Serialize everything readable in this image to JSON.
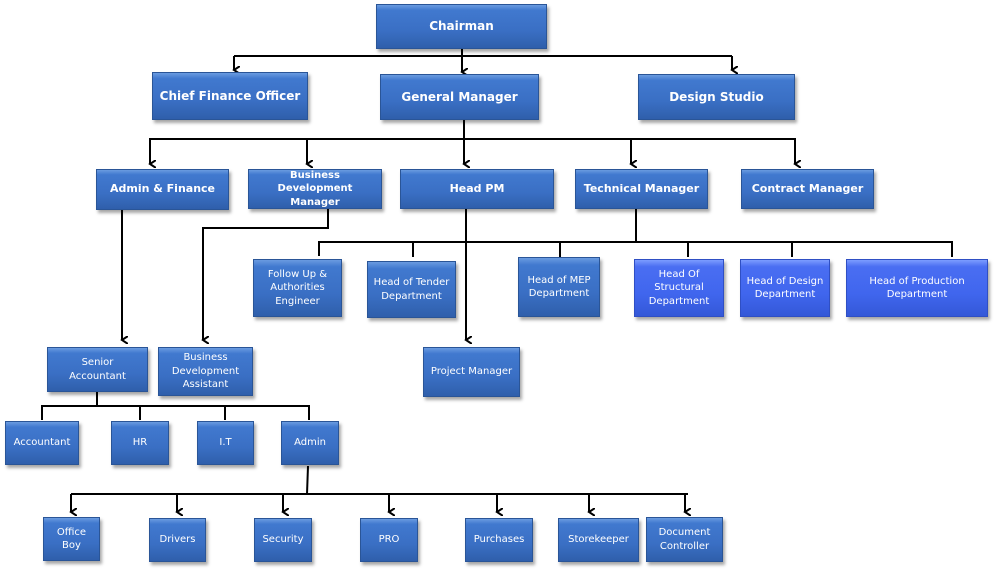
{
  "chart": {
    "nodes": {
      "chairman": "Chairman",
      "cfo": "Chief Finance Officer",
      "general_manager": "General Manager",
      "design_studio": "Design Studio",
      "admin_finance": "Admin & Finance",
      "bd_manager": "Business Development Manager",
      "head_pm": "Head PM",
      "technical_manager": "Technical Manager",
      "contract_manager": "Contract Manager",
      "follow_up_engineer": "Follow Up & Authorities Engineer",
      "head_tender": "Head of Tender Department",
      "head_mep": "Head of MEP Department",
      "head_structural": "Head Of Structural Department",
      "head_design": "Head of Design Department",
      "head_production": "Head of Production Department",
      "project_manager": "Project Manager",
      "senior_accountant": "Senior Accountant",
      "bd_assistant": "Business Development Assistant",
      "accountant": "Accountant",
      "hr": "HR",
      "it": "I.T",
      "admin": "Admin",
      "office_boy": "Office Boy",
      "drivers": "Drivers",
      "security": "Security",
      "pro": "PRO",
      "purchases": "Purchases",
      "storekeeper": "Storekeeper",
      "document_controller": "Document Controller"
    },
    "colors": {
      "box": "#3a6fc4",
      "box_highlight": "#4066ee",
      "connector": "#000000",
      "text": "#ffffff"
    }
  }
}
